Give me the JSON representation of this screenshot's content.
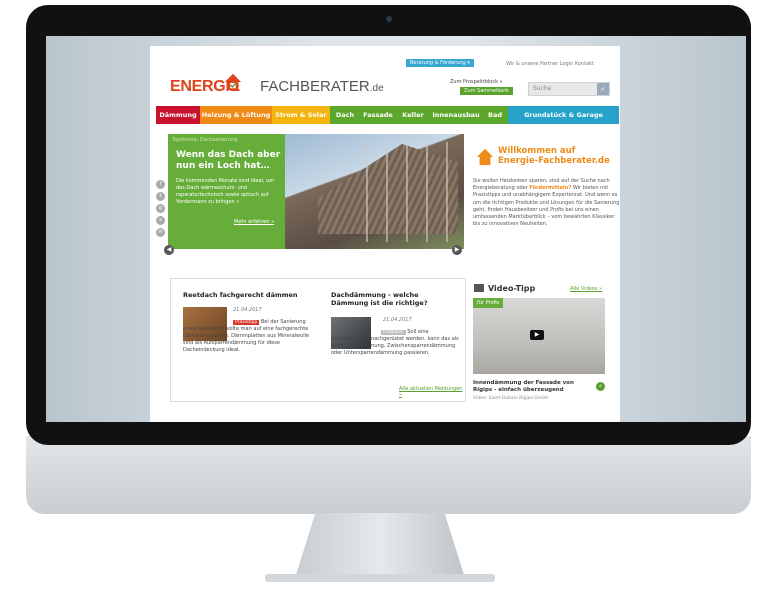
{
  "site": {
    "logo": {
      "energie": "ENERGIE",
      "fach": "FACHBERATER",
      "tld": ".de"
    },
    "top_button": "Beratung & Förderung ▾",
    "top_links": "Wir & unsere Partner   Login   Kontakt",
    "prospekt": "Zum Prospektblock »",
    "sammel": "Zum Sammelkorb",
    "search_placeholder": "Suche",
    "nav": [
      {
        "label": "Dämmung",
        "color": "#c8112d"
      },
      {
        "label": "Heizung & Lüftung",
        "color": "#ef8a16"
      },
      {
        "label": "Strom & Solar",
        "color": "#f2b40d"
      },
      {
        "label": "Dach",
        "color": "#5ba82c"
      },
      {
        "label": "Fassade",
        "color": "#5ba82c"
      },
      {
        "label": "Keller",
        "color": "#5ba82c"
      },
      {
        "label": "Innenausbau",
        "color": "#5ba82c"
      },
      {
        "label": "Bad",
        "color": "#5ba82c"
      },
      {
        "label": "Grundstück & Garage",
        "color": "#27a3c9"
      }
    ],
    "hero": {
      "topic": "Topthema: Dachsanierung",
      "title": "Wenn das Dach aber nun ein Loch hat…",
      "text": "Die kommenden Monate sind ideal, um das Dach wärmeschutz- und reparaturtechnisch sowie optisch auf Vordermann zu bringen »",
      "more": "Mehr erfahren »"
    },
    "welcome": {
      "title_line1": "Willkommen auf",
      "title_line2": "Energie-Fachberater.de",
      "text_a": "Sie wollen Heizkosten sparen, sind auf der Suche nach Energieberatung oder ",
      "text_highlight": "Fördermitteln?",
      "text_b": " Wir bieten mit Praxistipps und unabhängigem Expertenrat. Und wenn es um die richtigen Produkte und Lösungen für die Sanierung geht, finden Hausbesitzer und Profis bei uns einen umfassenden Marktüberblick – vom bewährten Klassiker bis zu innovativen Neuheiten."
    },
    "news": {
      "item1": {
        "title": "Reetdach fachgerecht dämmen",
        "date": "21.04.2017",
        "tag": "Praxistipp",
        "body": "Bei der Sanierung eines Reetdachs sollte man auf eine fachgerechte Dämmung achten. Dämmplatten aus Mineralwolle sind als Aufsparrendämmung für diese Dacheindeckung ideal."
      },
      "item2": {
        "title": "Dachdämmung - welche Dämmung ist die richtige?",
        "date": "21.04.2017",
        "tag": "Ratgeber",
        "body": "Soll eine Dachdämmung nachgerüstet werden, kann das als Aufsparrendämmung, Zwischensparrendämmung oder Untersparrendämmung passieren."
      },
      "all_link": "Alle aktuellen Meldungen »"
    },
    "video": {
      "label": "Video-Tipp",
      "all_link": "Alle Videos »",
      "badge": "für Profis",
      "caption": "Innendämmung der Fassade von Rigips - einfach überzeugend",
      "source": "Video: Saint-Gobain Rigips GmbH"
    }
  }
}
